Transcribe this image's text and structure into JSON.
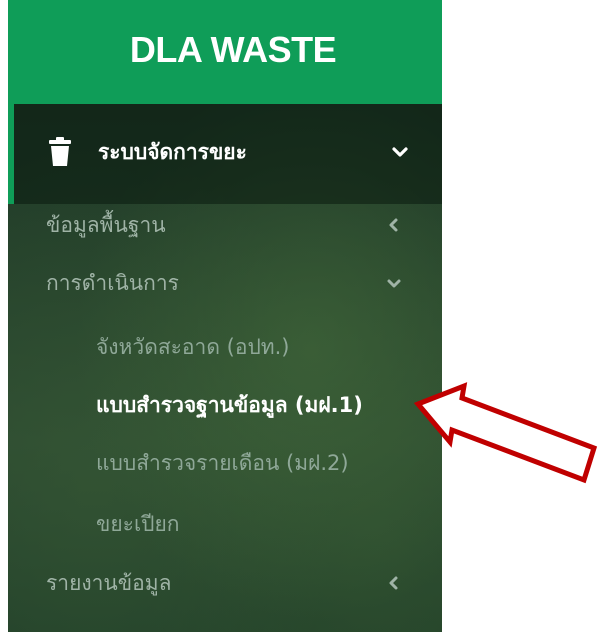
{
  "brand": {
    "title": "DLA WASTE"
  },
  "menu": {
    "module": {
      "label": "ระบบจัดการขยะ",
      "icon": "trash-icon",
      "expanded": true
    },
    "items": [
      {
        "label": "ข้อมูลพื้นฐาน",
        "expanded": false
      },
      {
        "label": "การดำเนินการ",
        "expanded": true,
        "children": [
          {
            "label": "จังหวัดสะอาด (อปท.)"
          },
          {
            "label": "แบบสำรวจฐานข้อมูล (มฝ.1)",
            "active": true
          },
          {
            "label": "แบบสำรวจรายเดือน (มฝ.2)"
          },
          {
            "label": "ขยะเปียก"
          }
        ]
      },
      {
        "label": "รายงานข้อมูล",
        "expanded": false
      }
    ]
  },
  "annotation": {
    "icon": "arrow-left-icon",
    "color": "#c00000"
  }
}
